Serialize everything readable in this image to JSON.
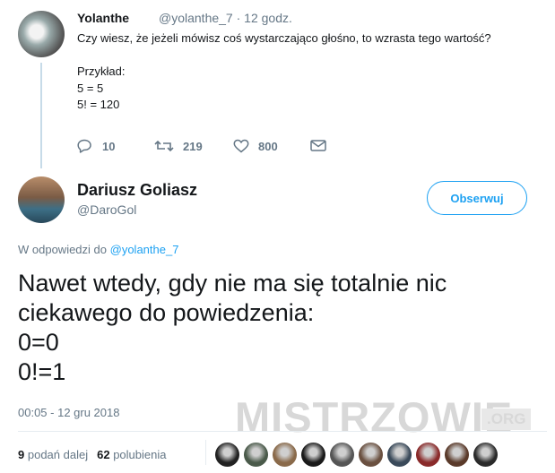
{
  "quoted_tweet": {
    "author_name": "Yolanthe",
    "author_handle": "@yolanthe_7 · 12 godz.",
    "lines": [
      "Czy wiesz, że jeżeli mówisz coś wystarczająco głośno, to wzrasta tego wartość?",
      " ",
      "Przykład:",
      "5 = 5",
      "5! = 120"
    ],
    "actions": {
      "reply_count": "10",
      "retweet_count": "219",
      "like_count": "800"
    }
  },
  "main_tweet": {
    "author_name": "Dariusz Goliasz",
    "author_handle": "@DaroGol",
    "follow_label": "Obserwuj",
    "reply_prefix": "W odpowiedzi do",
    "reply_to": "@yolanthe_7",
    "body_lines": [
      "Nawet wtedy, gdy nie ma się totalnie nic",
      "ciekawego do powiedzenia:",
      "0=0",
      "0!=1"
    ],
    "timestamp": "00:05 - 12 gru 2018",
    "stats": {
      "retweets_num": "9",
      "retweets_label": "podań dalej",
      "likes_num": "62",
      "likes_label": "polubienia"
    }
  },
  "watermark": {
    "text": "MISTRZOWIE",
    "suffix": ".ORG"
  },
  "likers_colors": [
    "#222222",
    "#4a5a4a",
    "#8a6a4a",
    "#1a1a1a",
    "#555555",
    "#6a5040",
    "#3a4a5a",
    "#8a2a2a",
    "#5a3a2a",
    "#2a2a2a"
  ]
}
